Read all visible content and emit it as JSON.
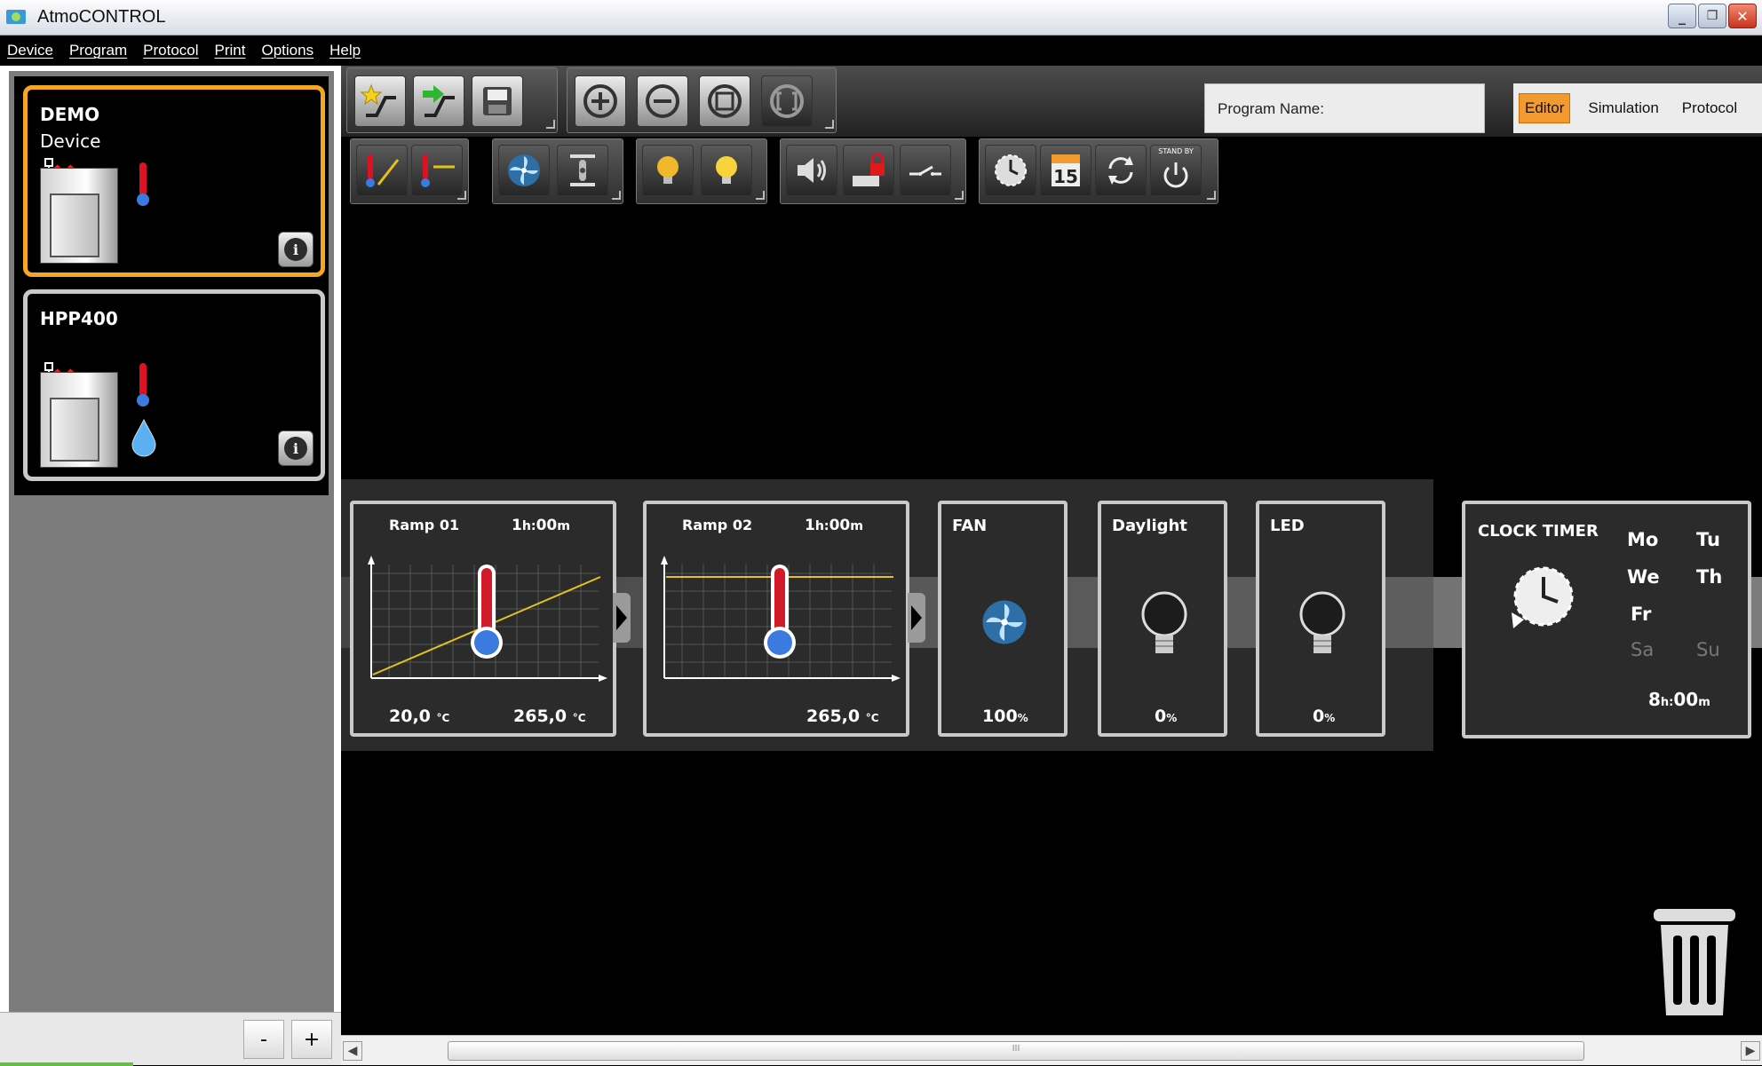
{
  "window": {
    "title": "AtmoCONTROL"
  },
  "menu": [
    "Device",
    "Program",
    "Protocol",
    "Print",
    "Options",
    "Help"
  ],
  "devices": [
    {
      "name": "DEMO",
      "subtitle": "Device"
    },
    {
      "name": "HPP400",
      "subtitle": ""
    }
  ],
  "sidebar_buttons": {
    "minus": "-",
    "plus": "+"
  },
  "program": {
    "name_label": "Program Name:"
  },
  "modes": {
    "editor": "Editor",
    "simulation": "Simulation",
    "protocol": "Protocol",
    "active": "Editor"
  },
  "standby_label": "STAND BY",
  "calendar_day": "15",
  "steps": {
    "ramp1": {
      "label": "Ramp 01",
      "time_h": "1",
      "time_m": "00",
      "start_value": "20,0",
      "end_value": "265,0",
      "unit": "°C"
    },
    "ramp2": {
      "label": "Ramp 02",
      "time_h": "1",
      "time_m": "00",
      "end_value": "265,0",
      "unit": "°C"
    },
    "fan": {
      "label": "FAN",
      "value": "100",
      "unit": "%"
    },
    "daylight": {
      "label": "Daylight",
      "value": "0",
      "unit": "%"
    },
    "led": {
      "label": "LED",
      "value": "0",
      "unit": "%"
    }
  },
  "clock_timer": {
    "title": "CLOCK TIMER",
    "days": {
      "mo": "Mo",
      "tu": "Tu",
      "we": "We",
      "th": "Th",
      "fr": "Fr",
      "sa": "Sa",
      "su": "Su"
    },
    "time_h": "8",
    "time_m": "00"
  },
  "scrollbar": {
    "grip": "III"
  },
  "colors": {
    "accent": "#f29a2e",
    "selected_border": "#f5a623",
    "card_border": "#c9c9c9"
  }
}
